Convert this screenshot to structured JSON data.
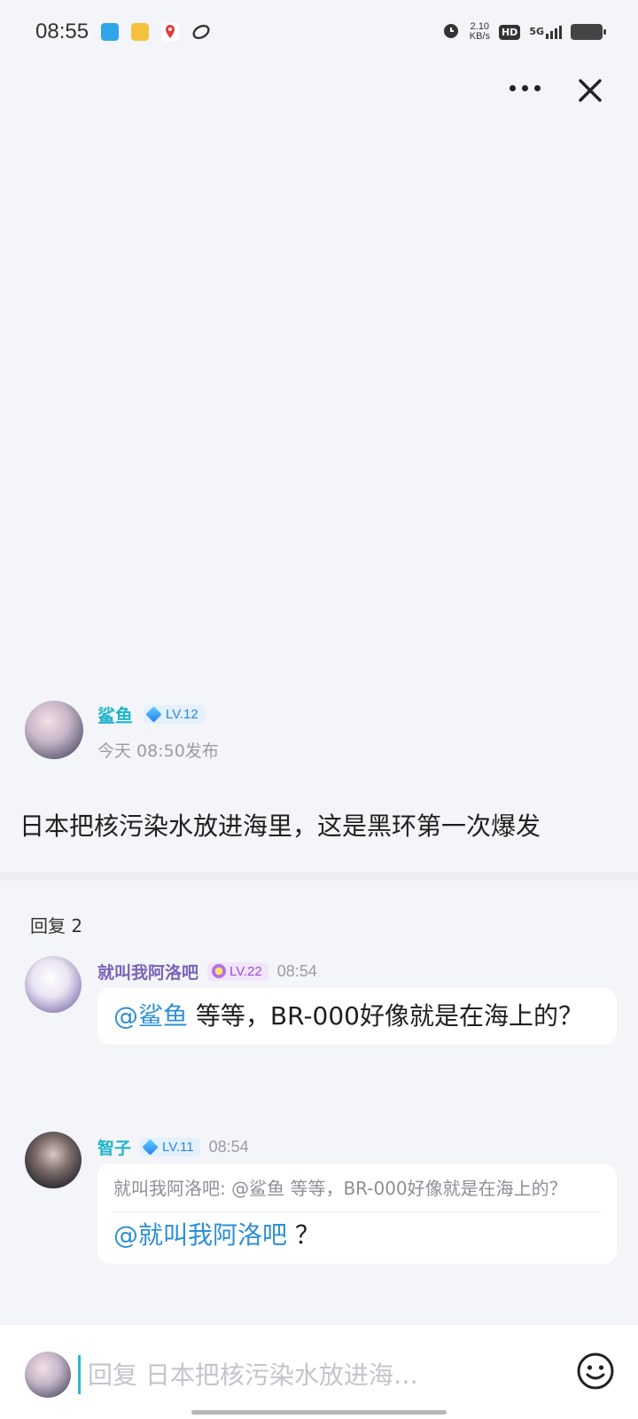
{
  "status_bar": {
    "time": "08:55",
    "speed_value": "2.10",
    "speed_unit": "KB/s",
    "hd": "HD",
    "network": "5G"
  },
  "post": {
    "author": "鲨鱼",
    "level": "LV.12",
    "published": "今天 08:50发布",
    "text": "日本把核污染水放进海里，这是黑环第一次爆发"
  },
  "replies_label": "回复 2",
  "comments": [
    {
      "name": "就叫我阿洛吧",
      "level": "LV.22",
      "time": "08:54",
      "mention": "@鲨鱼",
      "text": " 等等，BR-000好像就是在海上的？",
      "name_color": "#7a63b8"
    },
    {
      "name": "智子",
      "level": "LV.11",
      "time": "08:54",
      "quote": "就叫我阿洛吧: @鲨鱼 等等，BR-000好像就是在海上的？",
      "mention": "@就叫我阿洛吧",
      "text": " ？",
      "name_color": "#1fb5c9"
    }
  ],
  "reply_box": {
    "placeholder": "回复 日本把核污染水放进海…"
  },
  "icons": {
    "more": "more-dots-icon",
    "close": "close-icon",
    "emoji": "emoji-icon"
  }
}
